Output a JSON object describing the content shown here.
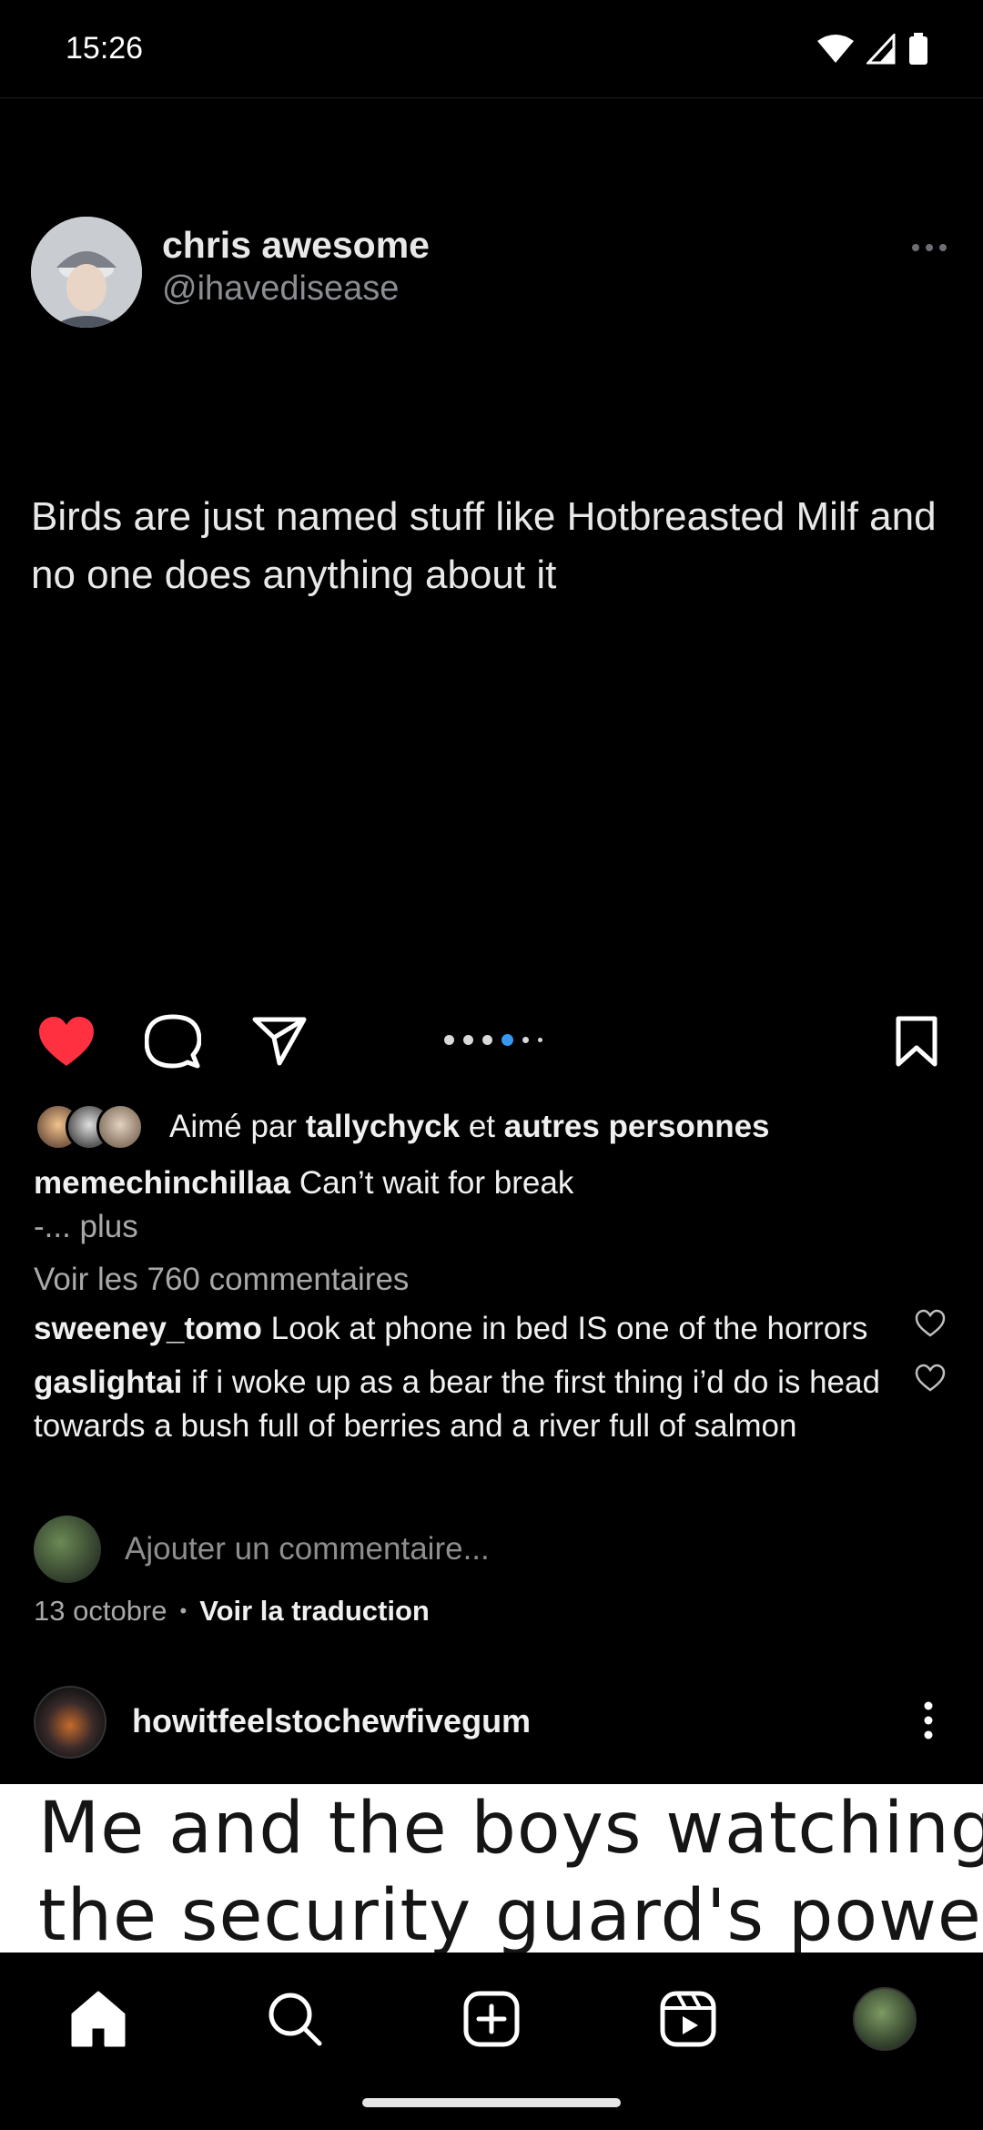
{
  "status_bar": {
    "time": "15:26"
  },
  "tweet": {
    "display_name": "chris awesome",
    "handle": "@ihavedisease",
    "text": "Birds are just named stuff like Hotbreasted Milf and no one does anything about it"
  },
  "carousel": {
    "count": 6,
    "active_index": 3
  },
  "likes": {
    "prefix": "Aimé par",
    "user": "tallychyck",
    "joiner": "et",
    "others": "autres personnes"
  },
  "caption": {
    "user": "memechinchillaa",
    "text": "Can’t wait for break",
    "more": "-... plus"
  },
  "view_comments": "Voir les 760 commentaires",
  "comments": [
    {
      "user": "sweeney_tomo",
      "text": "Look at phone in bed IS one of the horrors"
    },
    {
      "user": "gaslightai",
      "text": "if i woke up as a bear the first thing i’d do is head towards a bush full of berries and a river full of salmon"
    }
  ],
  "add_comment_placeholder": "Ajouter un commentaire...",
  "post_meta": {
    "date": "13 octobre",
    "translate": "Voir la traduction"
  },
  "next_post": {
    "user": "howitfeelstochewfivegum",
    "meme_lines": [
      "Me and the boys watching",
      "the security guard's power"
    ]
  },
  "colors": {
    "like_red": "#ff3040",
    "active_dot": "#3897f0",
    "background": "#000000"
  }
}
